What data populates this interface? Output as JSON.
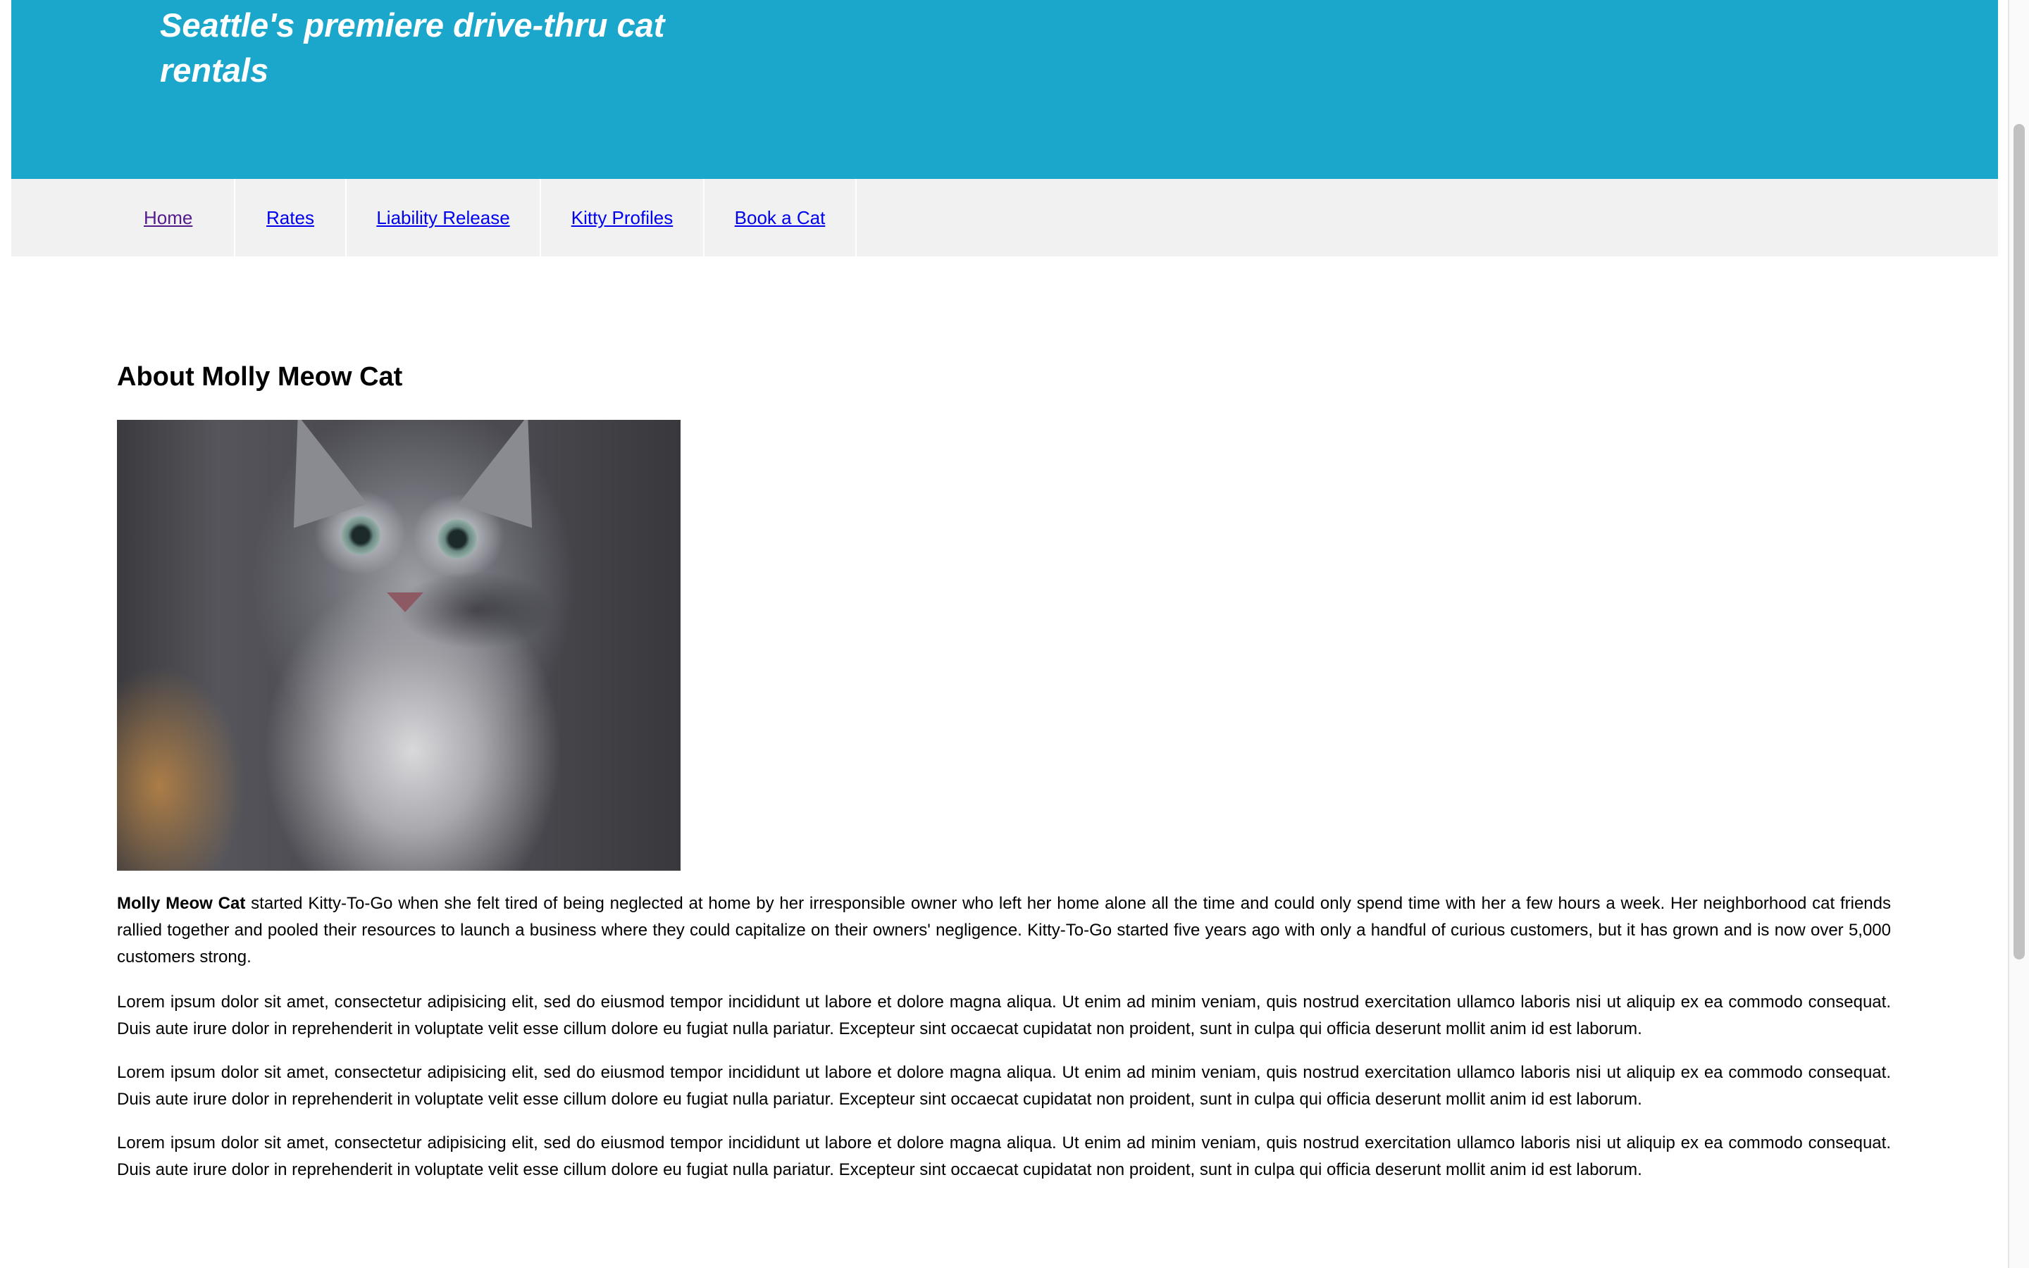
{
  "header": {
    "tagline": "Seattle's premiere drive-thru cat rentals"
  },
  "nav": {
    "items": [
      {
        "label": "Home"
      },
      {
        "label": "Rates"
      },
      {
        "label": "Liability Release"
      },
      {
        "label": "Kitty Profiles"
      },
      {
        "label": "Book a Cat"
      }
    ]
  },
  "main": {
    "title": "About Molly Meow Cat",
    "photo_icon": "kitten-photo",
    "intro_name": "Molly Meow Cat",
    "intro_text": " started Kitty-To-Go when she felt tired of being neglected at home by her irresponsible owner who left her home alone all the time and could only spend time with her a few hours a week. Her neighborhood cat friends rallied together and pooled their resources to launch a business where they could capitalize on their owners' negligence. Kitty-To-Go started five years ago with only a handful of curious customers, but it has grown and is now over 5,000 customers strong.",
    "paragraphs": [
      "Lorem ipsum dolor sit amet, consectetur adipisicing elit, sed do eiusmod tempor incididunt ut labore et dolore magna aliqua. Ut enim ad minim veniam, quis nostrud exercitation ullamco laboris nisi ut aliquip ex ea commodo consequat. Duis aute irure dolor in reprehenderit in voluptate velit esse cillum dolore eu fugiat nulla pariatur. Excepteur sint occaecat cupidatat non proident, sunt in culpa qui officia deserunt mollit anim id est laborum.",
      "Lorem ipsum dolor sit amet, consectetur adipisicing elit, sed do eiusmod tempor incididunt ut labore et dolore magna aliqua. Ut enim ad minim veniam, quis nostrud exercitation ullamco laboris nisi ut aliquip ex ea commodo consequat. Duis aute irure dolor in reprehenderit in voluptate velit esse cillum dolore eu fugiat nulla pariatur. Excepteur sint occaecat cupidatat non proident, sunt in culpa qui officia deserunt mollit anim id est laborum.",
      "Lorem ipsum dolor sit amet, consectetur adipisicing elit, sed do eiusmod tempor incididunt ut labore et dolore magna aliqua. Ut enim ad minim veniam, quis nostrud exercitation ullamco laboris nisi ut aliquip ex ea commodo consequat. Duis aute irure dolor in reprehenderit in voluptate velit esse cillum dolore eu fugiat nulla pariatur. Excepteur sint occaecat cupidatat non proident, sunt in culpa qui officia deserunt mollit anim id est laborum."
    ]
  },
  "colors": {
    "header_bg": "#1ba6cb",
    "nav_bg": "#f1f1f1",
    "link": "#0000ee",
    "visited_link": "#551a8b"
  }
}
